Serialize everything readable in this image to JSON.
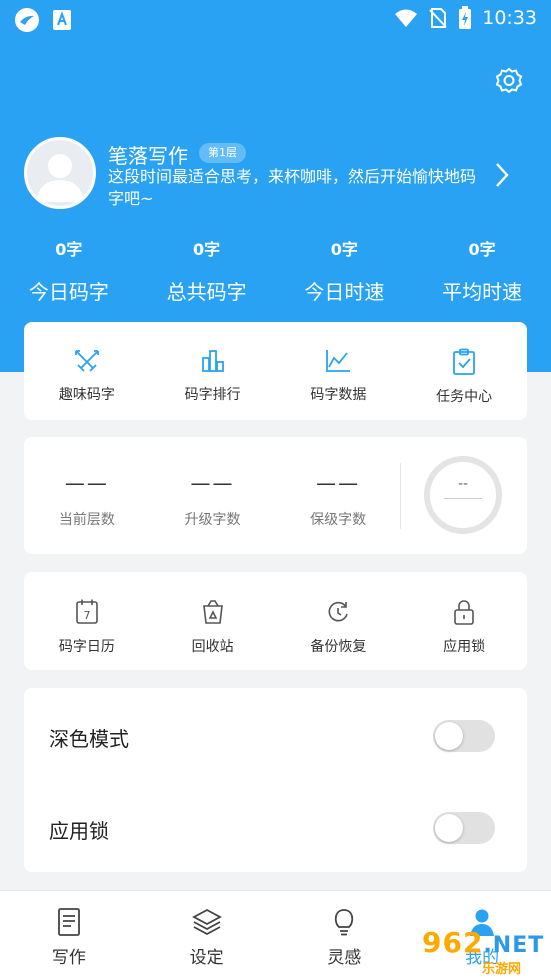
{
  "status_bar": {
    "time": "10:33"
  },
  "header": {
    "settings_icon": "gear-icon"
  },
  "profile": {
    "name": "笔落写作",
    "level": "第1层",
    "motto": "这段时间最适合思考，来杯咖啡，然后开始愉快地码字吧~"
  },
  "stats": [
    {
      "value": "0字",
      "label": "今日码字"
    },
    {
      "value": "0字",
      "label": "总共码字"
    },
    {
      "value": "0字",
      "label": "今日时速"
    },
    {
      "value": "0字",
      "label": "平均时速"
    }
  ],
  "features": [
    {
      "label": "趣味码字",
      "icon": "crossed-swords-icon"
    },
    {
      "label": "码字排行",
      "icon": "bar-ranking-icon"
    },
    {
      "label": "码字数据",
      "icon": "line-chart-icon"
    },
    {
      "label": "任务中心",
      "icon": "clipboard-check-icon"
    }
  ],
  "level_metrics": [
    {
      "value": "——",
      "label": "当前层数"
    },
    {
      "value": "——",
      "label": "升级字数"
    },
    {
      "value": "——",
      "label": "保级字数"
    }
  ],
  "ring": {
    "value": "--"
  },
  "tools": [
    {
      "label": "码字日历",
      "icon": "calendar-icon",
      "day": "7"
    },
    {
      "label": "回收站",
      "icon": "recycle-bin-icon"
    },
    {
      "label": "备份恢复",
      "icon": "backup-restore-icon"
    },
    {
      "label": "应用锁",
      "icon": "lock-icon"
    }
  ],
  "toggles": [
    {
      "label": "深色模式",
      "on": false
    },
    {
      "label": "应用锁",
      "on": false
    }
  ],
  "nav": [
    {
      "label": "写作",
      "icon": "document-icon"
    },
    {
      "label": "设定",
      "icon": "layers-icon"
    },
    {
      "label": "灵感",
      "icon": "lightbulb-icon"
    },
    {
      "label": "我的",
      "icon": "user-icon",
      "active": true
    }
  ],
  "colors": {
    "primary": "#29a2f4",
    "background": "#f2f3f5"
  },
  "watermark": {
    "text": "962",
    "suffix": ".NET",
    "sub": "乐游网"
  }
}
